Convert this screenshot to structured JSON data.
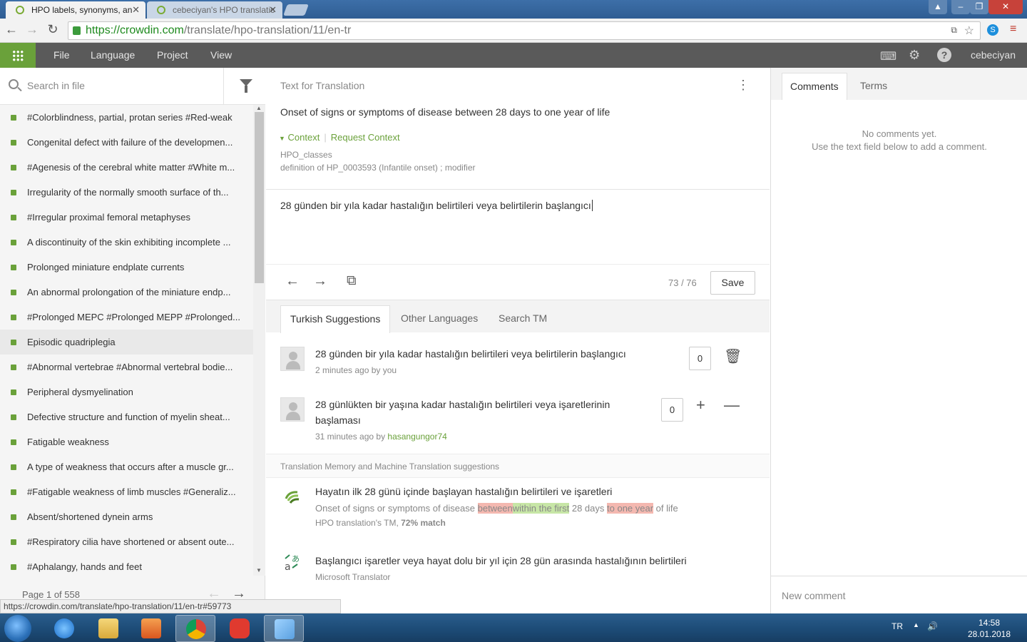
{
  "browser": {
    "tabs": [
      {
        "title": "HPO labels, synonyms, an"
      },
      {
        "title": "cebeciyan's HPO translatic"
      }
    ],
    "url_host": "https://crowdin.com",
    "url_path": "/translate/hpo-translation/11/en-tr",
    "status_url": "https://crowdin.com/translate/hpo-translation/11/en-tr#59773"
  },
  "header": {
    "menus": [
      "File",
      "Language",
      "Project",
      "View"
    ],
    "username": "cebeciyan",
    "icons": [
      "apps-grid-icon",
      "keyboard-icon",
      "gear-icon",
      "help-icon"
    ]
  },
  "left": {
    "search_placeholder": "Search in file",
    "strings": [
      "#Colorblindness, partial, protan series #Red-weak",
      "Congenital defect with failure of the developmen...",
      "#Agenesis of the cerebral white matter #White m...",
      "Irregularity of the normally smooth surface of th...",
      "#Irregular proximal femoral metaphyses",
      "A discontinuity of the skin exhibiting incomplete ...",
      "Prolonged miniature endplate currents",
      "An abnormal prolongation of the miniature endp...",
      "#Prolonged MEPC #Prolonged MEPP #Prolonged...",
      "Episodic quadriplegia",
      "#Abnormal vertebrae #Abnormal vertebral bodie...",
      "Peripheral dysmyelination",
      "Defective structure and function of myelin sheat...",
      "Fatigable weakness",
      "A type of weakness that occurs after a muscle gr...",
      "#Fatigable weakness of limb muscles #Generaliz...",
      "Absent/shortened dynein arms",
      "#Respiratory cilia have shortened or absent oute...",
      "#Aphalangy, hands and feet"
    ],
    "selected_index": 9,
    "pager": "Page 1 of 558",
    "status_color": "#6aa13a"
  },
  "center": {
    "source_heading": "Text for Translation",
    "source_text": "Onset of signs or symptoms of disease between 28 days to one year of life",
    "context_label": "Context",
    "request_context": "Request Context",
    "context_lines": [
      "HPO_classes",
      "definition of HP_0003593 (Infantile onset) ; modifier"
    ],
    "translation": "28 günden bir yıla kadar hastalığın belirtileri veya belirtilerin başlangıcı",
    "char_count": "73 / 76",
    "save_label": "Save",
    "suggestion_tabs": [
      "Turkish Suggestions",
      "Other Languages",
      "Search TM"
    ],
    "suggestions": [
      {
        "text": "28 günden bir yıla kadar hastalığın belirtileri veya belirtilerin başlangıcı",
        "meta_prefix": "2 minutes ago by ",
        "user": "you",
        "votes": "0"
      },
      {
        "text_line1": "28 günlükten bir yaşına kadar hastalığın belirtileri veya işaretlerinin",
        "text_line2": "başlaması",
        "meta_prefix": "31 minutes ago by ",
        "user": "hasangungor74",
        "votes": "0"
      }
    ],
    "tm_heading": "Translation Memory and Machine Translation suggestions",
    "tm": {
      "text": "Hayatın ilk 28 günü içinde başlayan hastalığın belirtileri ve işaretleri",
      "diff_before": "Onset of signs or symptoms of disease ",
      "diff_del1": "between",
      "diff_ins1": "within the first",
      "diff_mid": " 28 days ",
      "diff_del2": "to one year",
      "diff_after": " of life",
      "source_prefix": "HPO translation's TM, ",
      "match": "72% match"
    },
    "mt": {
      "text": "Başlangıcı işaretler veya hayat dolu bir yıl için 28 gün arasında hastalığının belirtileri",
      "source": "Microsoft Translator"
    }
  },
  "right": {
    "tabs": [
      "Comments",
      "Terms"
    ],
    "empty_line1": "No comments yet.",
    "empty_line2": "Use the text field below to add a comment.",
    "new_comment_placeholder": "New comment"
  },
  "taskbar": {
    "lang": "TR",
    "time": "14:58",
    "date": "28.01.2018"
  }
}
